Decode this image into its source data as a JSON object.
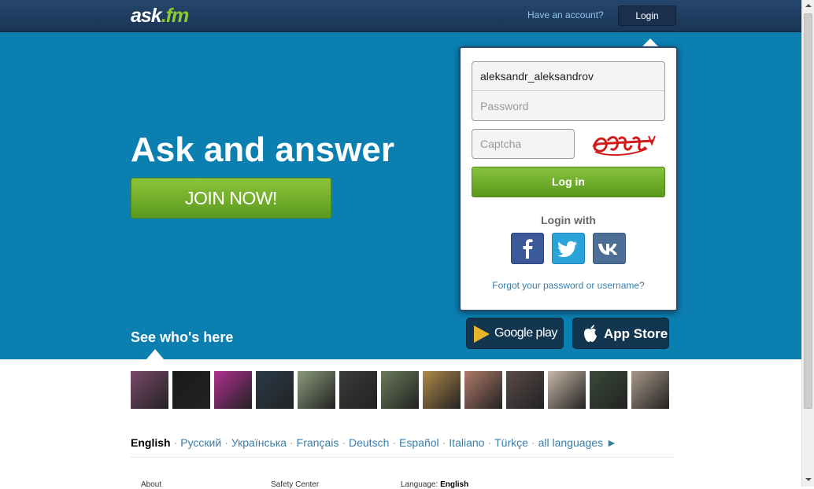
{
  "header": {
    "logo_main": "ask",
    "logo_dot": ".fm",
    "have_account": "Have an account?",
    "login_label": "Login"
  },
  "hero": {
    "headline": "Ask and answer",
    "join_label": "JOIN NOW!",
    "see_who": "See who's here"
  },
  "login_panel": {
    "username_value": "aleksandr_aleksandrov",
    "password_placeholder": "Password",
    "captcha_placeholder": "Captcha",
    "login_button": "Log in",
    "login_with": "Login with",
    "forgot": "Forgot your password or username?",
    "social": [
      "facebook-icon",
      "twitter-icon",
      "vk-icon"
    ]
  },
  "stores": {
    "google_play": "Google play",
    "app_store": "App Store"
  },
  "avatars": [
    {
      "color": "#7a4b6a"
    },
    {
      "color": "#1a1a1a"
    },
    {
      "color": "#b03090"
    },
    {
      "color": "#2a3a4a"
    },
    {
      "color": "#8a9a7a"
    },
    {
      "color": "#3a3a3a"
    },
    {
      "color": "#6a7a5a"
    },
    {
      "color": "#b08a4a"
    },
    {
      "color": "#b07a6a"
    },
    {
      "color": "#5a4a4a"
    },
    {
      "color": "#c8b8a8"
    },
    {
      "color": "#3a4a3a"
    },
    {
      "color": "#a89888"
    }
  ],
  "languages": {
    "items": [
      "English",
      "Русский",
      "Українська",
      "Français",
      "Deutsch",
      "Español",
      "Italiano",
      "Türkçe",
      "all languages ►"
    ],
    "active": "English"
  },
  "footer": {
    "about": "About",
    "safety": "Safety Center",
    "language_label": "Language:",
    "language_value": "English"
  },
  "colors": {
    "hero_bg": "#0b7fb0",
    "topbar_bg": "#1f3d62",
    "accent_green": "#6aaa25",
    "link_blue": "#3a7ca8"
  }
}
